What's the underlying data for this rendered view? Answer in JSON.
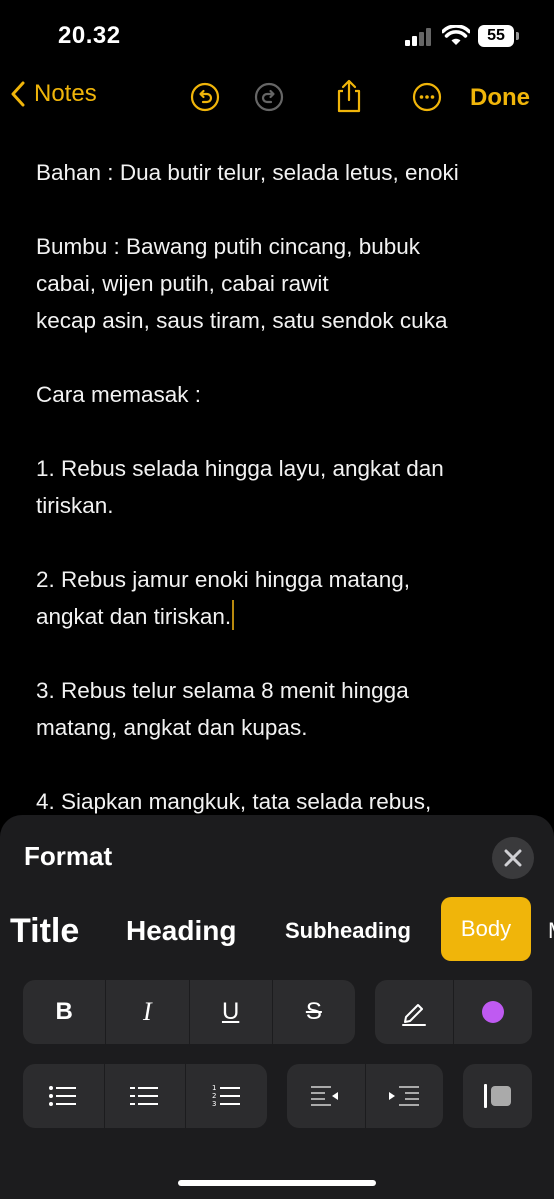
{
  "status": {
    "time": "20.32",
    "battery": "55"
  },
  "nav": {
    "back_label": "Notes",
    "done_label": "Done"
  },
  "note": {
    "lines": [
      "Bahan : Dua butir telur, selada letus, enoki",
      "",
      "Bumbu : Bawang putih cincang, bubuk",
      "cabai, wijen putih, cabai rawit",
      "kecap asin, saus tiram, satu sendok cuka",
      "",
      "Cara memasak :",
      "",
      "1. Rebus selada hingga layu, angkat dan",
      "tiriskan.",
      "",
      "2. Rebus jamur enoki hingga matang,",
      "angkat dan tiriskan.",
      "",
      "3. Rebus telur selama 8 menit hingga",
      "matang, angkat dan kupas.",
      "",
      "4. Siapkan mangkuk, tata selada rebus,"
    ]
  },
  "format": {
    "title": "Format",
    "styles": {
      "title": "Title",
      "heading": "Heading",
      "subheading": "Subheading",
      "body": "Body",
      "more": "M"
    },
    "text_buttons": {
      "bold": "B",
      "italic": "I",
      "underline": "U",
      "strike": "S"
    },
    "colors": {
      "accent": "#f0b50a",
      "color_dot": "#bf5af2"
    }
  }
}
